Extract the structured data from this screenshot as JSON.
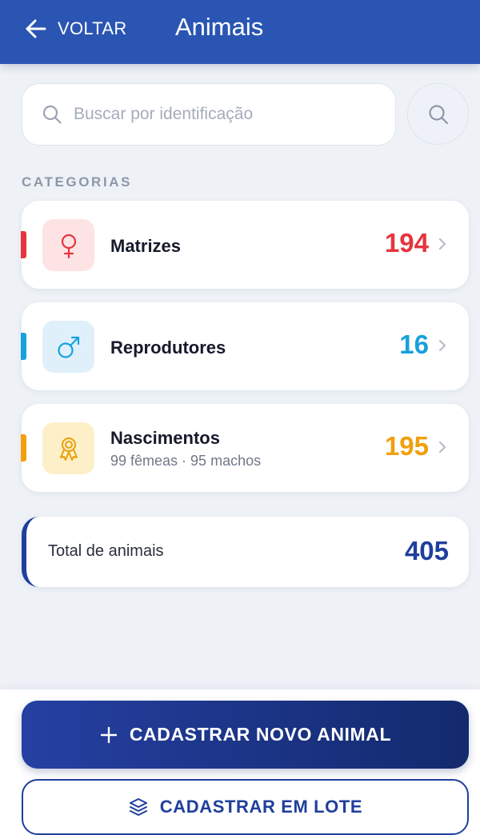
{
  "header": {
    "back_label": "VOLTAR",
    "title": "Animais",
    "bg_color": "#2a55b3"
  },
  "search": {
    "placeholder": "Buscar por identificação",
    "value": "",
    "icon": "search-icon",
    "button_icon": "search-icon"
  },
  "categories": {
    "section_label": "CATEGORIAS",
    "items": [
      {
        "label": "Matrizes",
        "count": "194",
        "icon": "female-symbol-icon",
        "color": "#e5353e"
      },
      {
        "label": "Reprodutores",
        "count": "16",
        "icon": "male-symbol-icon",
        "color": "#16a1dc"
      },
      {
        "label": "Nascimentos",
        "sub": "99 fêmeas · 95 machos",
        "count": "195",
        "icon": "award-ribbon-icon",
        "color": "#f0a00e"
      }
    ]
  },
  "total": {
    "label": "Total de animais",
    "count": "405",
    "color": "#1f3f9c"
  },
  "actions": {
    "primary_label": "CADASTRAR NOVO ANIMAL",
    "primary_icon": "plus-icon",
    "secondary_label": "CADASTRAR EM LOTE",
    "secondary_icon": "layers-icon"
  }
}
